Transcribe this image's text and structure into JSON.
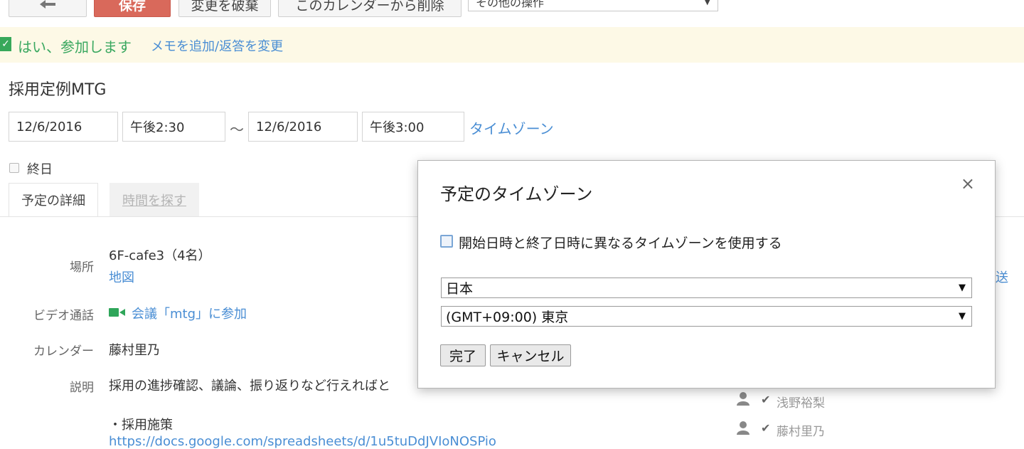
{
  "toolbar": {
    "back_icon": "back-arrow-icon",
    "save_label": "保存",
    "discard_label": "変更を破棄",
    "delete_label": "このカレンダーから削除",
    "more_actions_label": "その他の操作"
  },
  "rsvp": {
    "status": "はい、参加します",
    "link": "メモを追加/返答を変更"
  },
  "event": {
    "title": "採用定例MTG",
    "start_date": "12/6/2016",
    "start_time": "午後2:30",
    "separator": "～",
    "end_date": "12/6/2016",
    "end_time": "午後3:00",
    "timezone_link": "タイムゾーン",
    "all_day_label": "終日"
  },
  "tabs": {
    "details": "予定の詳細",
    "find_time": "時間を探す"
  },
  "details": {
    "location_label": "場所",
    "location_value": "6F-cafe3（4名）",
    "map_link": "地図",
    "video_label": "ビデオ通話",
    "video_link": "会議「mtg」に参加",
    "calendar_label": "カレンダー",
    "calendar_value": "藤村里乃",
    "description_label": "説明",
    "description_value": "採用の進捗確認、議論、振り返りなど行えればと",
    "description_item": "・採用施策",
    "description_url": "https://docs.google.com/spreadsheets/d/1u5tuDdJVIoNOSPio"
  },
  "right_edge_link": "送",
  "guests": [
    {
      "name": "浅野裕梨"
    },
    {
      "name": "藤村里乃"
    }
  ],
  "modal": {
    "title": "予定のタイムゾーン",
    "close_glyph": "×",
    "checkbox_label": "開始日時と終了日時に異なるタイムゾーンを使用する",
    "country_value": "日本",
    "timezone_value": "(GMT+09:00) 東京",
    "done_label": "完了",
    "cancel_label": "キャンセル"
  }
}
